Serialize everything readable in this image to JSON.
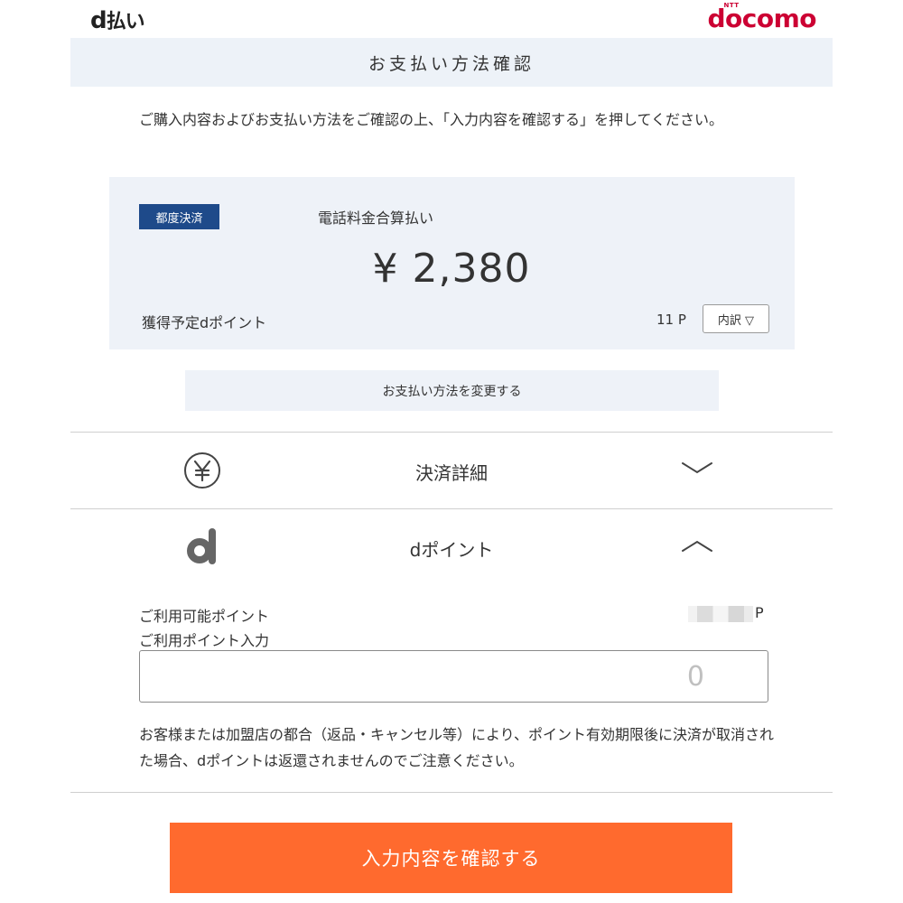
{
  "header": {
    "dpay_logo_d": "d",
    "dpay_logo_text": "払い",
    "docomo_ntt": "NTT",
    "docomo_logo": "docomo",
    "brand_color": "#cc0033"
  },
  "page_title": "お支払い方法確認",
  "intro_text": "ご購入内容およびお支払い方法をご確認の上、「入力内容を確認する」を押してください。",
  "payment": {
    "badge": "都度決済",
    "badge_color": "#1e4a8a",
    "method": "電話料金合算払い",
    "amount": "¥ 2,380",
    "points_label": "獲得予定dポイント",
    "points_value": "11 P",
    "breakdown_button": "内訳 ▽"
  },
  "change_method_button": "お支払い方法を変更する",
  "sections": {
    "settlement": {
      "label": "決済詳細",
      "icon": "yen-circle-icon",
      "state": "collapsed"
    },
    "dpoint": {
      "label": "dポイント",
      "icon": "d-point-logo-icon",
      "state": "expanded"
    }
  },
  "dpoint_panel": {
    "available_label": "ご利用可能ポイント",
    "available_unit": "P",
    "use_label": "ご利用ポイント入力",
    "input_placeholder": "0",
    "notice": "お客様または加盟店の都合（返品・キャンセル等）により、ポイント有効期限後に決済が取消された場合、dポイントは返還されませんのでご注意ください。"
  },
  "confirm_button": "入力内容を確認する",
  "accent_color": "#ff6a2e"
}
